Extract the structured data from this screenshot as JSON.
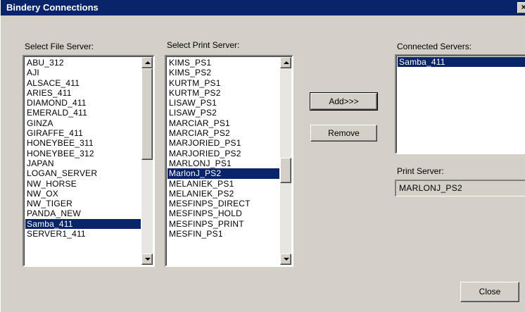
{
  "window": {
    "title": "Bindery Connections",
    "close_glyph": "×"
  },
  "file_server": {
    "label": "Select File Server:",
    "items": [
      "ABU_312",
      "AJI",
      "ALSACE_411",
      "ARIES_411",
      "DIAMOND_411",
      "EMERALD_411",
      "GINZA",
      "GIRAFFE_411",
      "HONEYBEE_311",
      "HONEYBEE_312",
      "JAPAN",
      "LOGAN_SERVER",
      "NW_HORSE",
      "NW_OX",
      "NW_TIGER",
      "PANDA_NEW",
      "Samba_411",
      "SERVER1_411"
    ],
    "selected": "Samba_411"
  },
  "print_server_list": {
    "label": "Select Print Server:",
    "items": [
      "KIMS_PS1",
      "KIMS_PS2",
      "KURTM_PS1",
      "KURTM_PS2",
      "LISAW_PS1",
      "LISAW_PS2",
      "MARCIAR_PS1",
      "MARCIAR_PS2",
      "MARJORIED_PS1",
      "MARJORIED_PS2",
      "MARLONJ_PS1",
      "MarlonJ_PS2",
      "MELANIEK_PS1",
      "MELANIEK_PS2",
      "MESFINPS_DIRECT",
      "MESFINPS_HOLD",
      "MESFINPS_PRINT",
      "MESFIN_PS1"
    ],
    "selected": "MarlonJ_PS2"
  },
  "connected": {
    "label": "Connected Servers:",
    "items": [
      "Samba_411"
    ],
    "selected": "Samba_411"
  },
  "print_server_field": {
    "label": "Print Server:",
    "value": "MARLONJ_PS2"
  },
  "buttons": {
    "add": "Add>>>",
    "remove": "Remove",
    "close": "Close"
  },
  "colors": {
    "face": "#d4d0c8",
    "selection": "#0a246a",
    "title_bar": "#0a246a"
  },
  "icons": {
    "scroll_up": "triangle-up-icon",
    "scroll_down": "triangle-down-icon"
  }
}
